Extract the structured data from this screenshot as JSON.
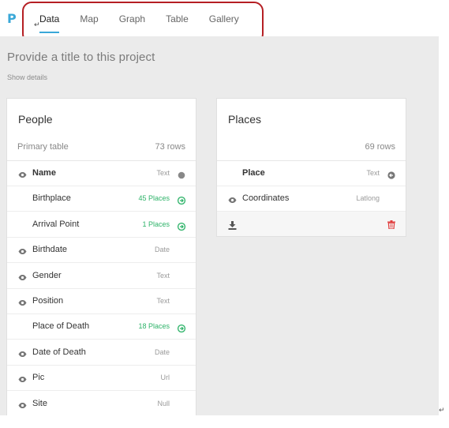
{
  "app": {
    "logo": "P"
  },
  "tabs": [
    {
      "label": "Data",
      "active": true
    },
    {
      "label": "Map",
      "active": false
    },
    {
      "label": "Graph",
      "active": false
    },
    {
      "label": "Table",
      "active": false
    },
    {
      "label": "Gallery",
      "active": false
    }
  ],
  "project": {
    "title_placeholder": "Provide a title to this project",
    "show_details": "Show details"
  },
  "people": {
    "title": "People",
    "subtitle": "Primary table",
    "row_count": "73 rows",
    "fields": [
      {
        "name": "Name",
        "type": "Text",
        "visible": true,
        "primary": true,
        "icon": "dot-icon"
      },
      {
        "name": "Birthplace",
        "type": "45 Places",
        "visible": false,
        "link": true,
        "icon": "arrow-right-icon"
      },
      {
        "name": "Arrival Point",
        "type": "1 Places",
        "visible": false,
        "link": true,
        "icon": "arrow-right-icon"
      },
      {
        "name": "Birthdate",
        "type": "Date",
        "visible": true
      },
      {
        "name": "Gender",
        "type": "Text",
        "visible": true
      },
      {
        "name": "Position",
        "type": "Text",
        "visible": true
      },
      {
        "name": "Place of Death",
        "type": "18 Places",
        "visible": false,
        "link": true,
        "icon": "arrow-right-icon"
      },
      {
        "name": "Date of Death",
        "type": "Date",
        "visible": true
      },
      {
        "name": "Pic",
        "type": "Url",
        "visible": true
      },
      {
        "name": "Site",
        "type": "Null",
        "visible": true
      }
    ]
  },
  "places": {
    "title": "Places",
    "row_count": "69 rows",
    "fields": [
      {
        "name": "Place",
        "type": "Text",
        "visible": false,
        "primary": true,
        "icon": "arrow-left-icon"
      },
      {
        "name": "Coordinates",
        "type": "Latlong",
        "visible": true
      }
    ]
  },
  "colors": {
    "accent": "#3aa8d8",
    "link": "#2eb369",
    "delete": "#e03b3b",
    "highlight": "#b51f24"
  }
}
